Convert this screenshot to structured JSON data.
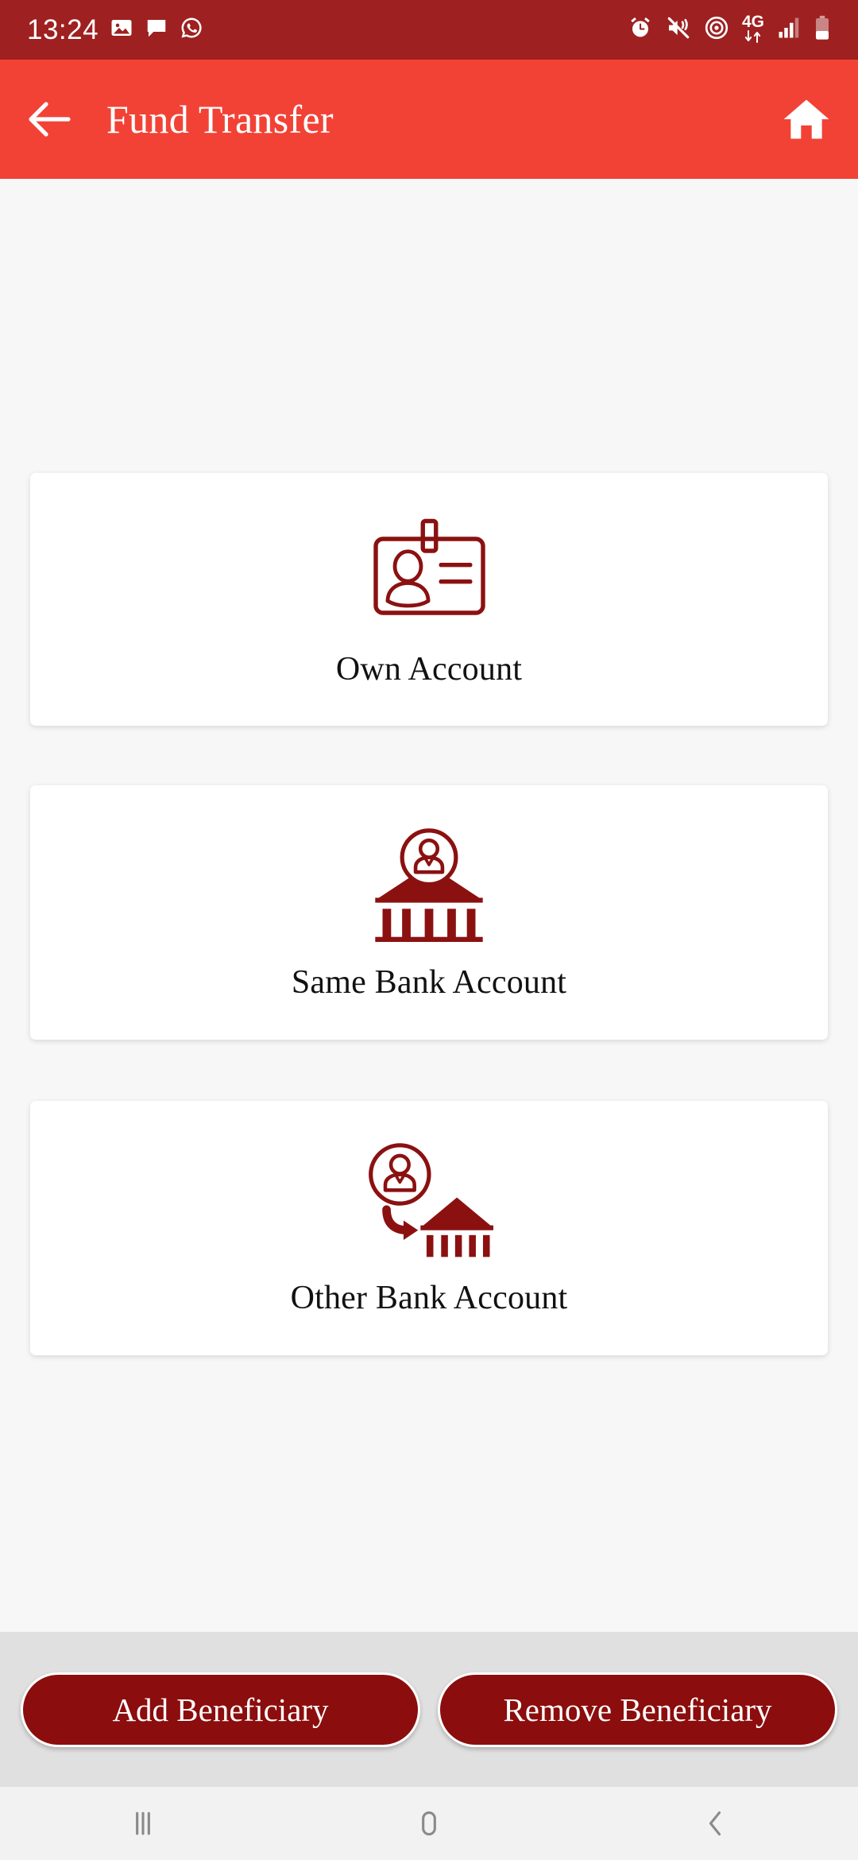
{
  "status_bar": {
    "time": "13:24",
    "network_type": "4G",
    "background_color": "#9e2020",
    "left_icons": [
      "gallery-icon",
      "chat-bubble-icon",
      "whatsapp-icon"
    ],
    "right_icons": [
      "alarm-icon",
      "mute-vibrate-icon",
      "hotspot-icon",
      "data-arrows-icon",
      "signal-bars-icon",
      "battery-icon"
    ]
  },
  "app_bar": {
    "title": "Fund Transfer",
    "back_icon": "arrow-left-icon",
    "home_icon": "home-icon",
    "background_color": "#f24236",
    "text_color": "#ffffff"
  },
  "main": {
    "background_color": "#f7f7f7",
    "accent_color": "#8b0d0d",
    "options": [
      {
        "label": "Own Account",
        "icon": "id-badge-icon"
      },
      {
        "label": "Same Bank Account",
        "icon": "bank-with-person-icon"
      },
      {
        "label": "Other Bank Account",
        "icon": "person-to-bank-transfer-icon"
      }
    ]
  },
  "action_bar": {
    "background_color": "#e0e0e0",
    "add_beneficiary_label": "Add Beneficiary",
    "remove_beneficiary_label": "Remove Beneficiary",
    "button_color": "#8b0d0d"
  },
  "nav_bar": {
    "background_color": "#f2f2f2",
    "recents_label": "recents-icon",
    "home_label": "home-icon",
    "back_label": "back-icon"
  }
}
